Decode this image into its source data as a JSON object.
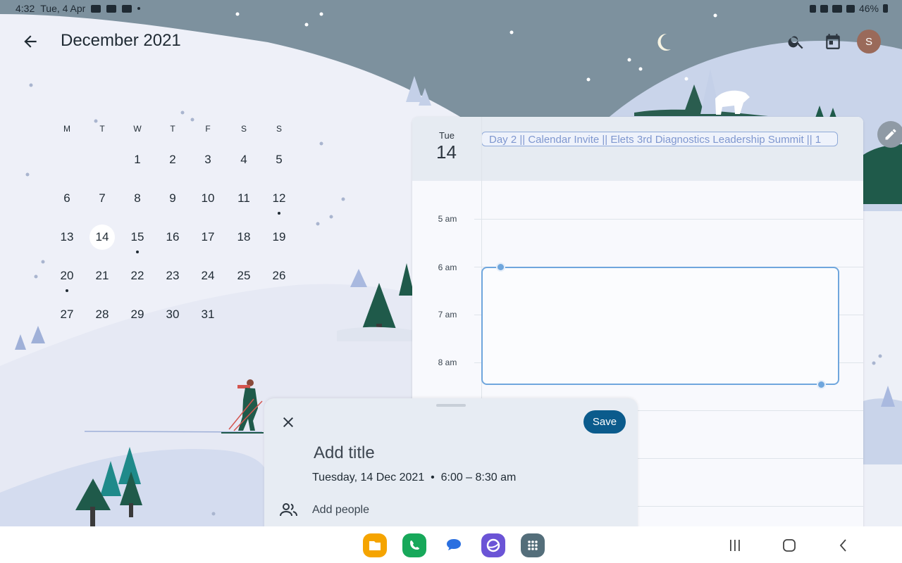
{
  "status": {
    "time": "4:32",
    "date": "Tue, 4 Apr",
    "battery": "46%"
  },
  "header": {
    "month_title": "December 2021",
    "avatar_initial": "S"
  },
  "month": {
    "weekdays": [
      "M",
      "T",
      "W",
      "T",
      "F",
      "S",
      "S"
    ],
    "today": "14",
    "weeks": [
      [
        "",
        "",
        "1",
        "2",
        "3",
        "4",
        "5"
      ],
      [
        "6",
        "7",
        "8",
        "9",
        "10",
        "11",
        "12"
      ],
      [
        "13",
        "14",
        "15",
        "16",
        "17",
        "18",
        "19"
      ],
      [
        "20",
        "21",
        "22",
        "23",
        "24",
        "25",
        "26"
      ],
      [
        "27",
        "28",
        "29",
        "30",
        "31",
        "",
        ""
      ]
    ],
    "days_with_events": [
      "12",
      "15",
      "20"
    ]
  },
  "day_view": {
    "weekday": "Tue",
    "day": "14",
    "allday_event": "Day 2 || Calendar Invite || Elets 3rd Diagnostics Leadership Summit || 1",
    "hours": [
      "5 am",
      "6 am",
      "7 am",
      "8 am"
    ]
  },
  "sheet": {
    "save_label": "Save",
    "title_placeholder": "Add title",
    "datetime": "Tuesday, 14 Dec 2021  •  6:00 – 8:30 am",
    "add_people": "Add people"
  },
  "dock": {
    "apps": [
      {
        "name": "files-app-icon",
        "color": "#f5a400"
      },
      {
        "name": "phone-app-icon",
        "color": "#17a85a"
      },
      {
        "name": "messages-app-icon",
        "color": "#2a6fe0"
      },
      {
        "name": "internet-app-icon",
        "color": "#6b54d6"
      },
      {
        "name": "apps-drawer-icon",
        "color": "#546e7a"
      }
    ]
  }
}
